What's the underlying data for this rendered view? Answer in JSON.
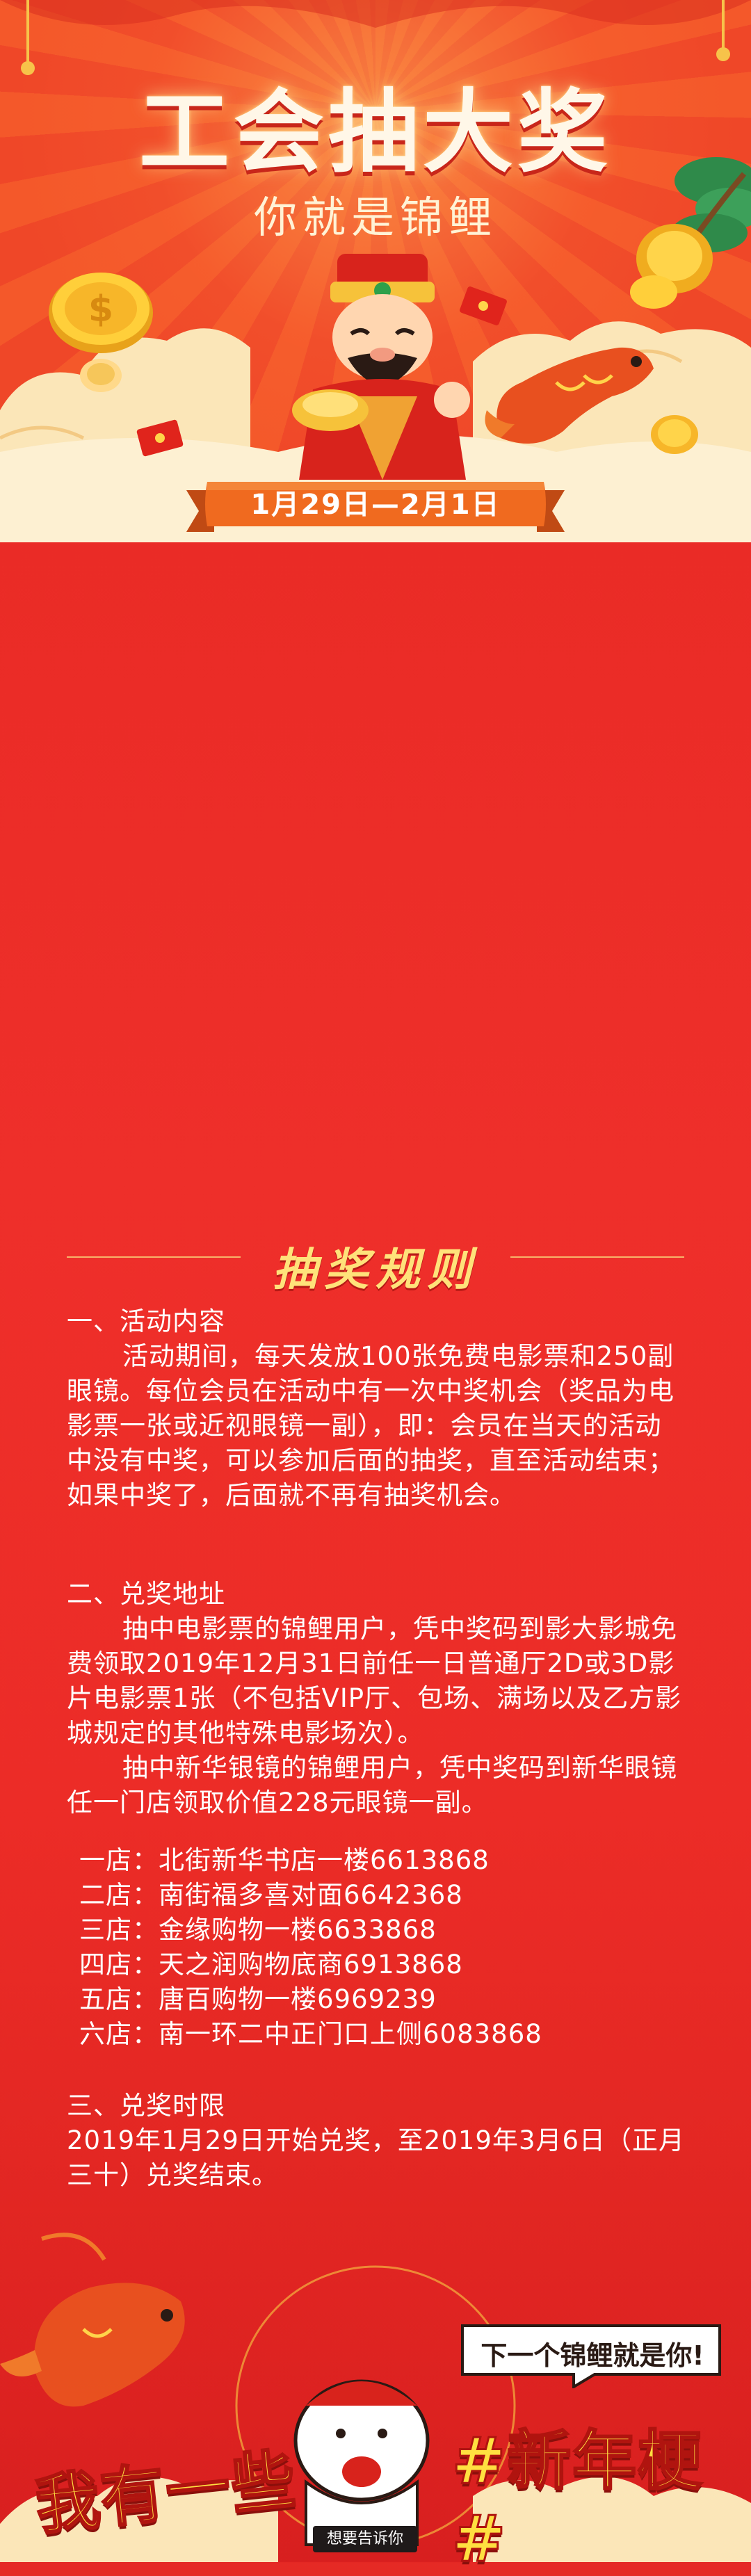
{
  "header": {
    "title": "工会抽大奖",
    "subtitle": "你就是锦鲤",
    "date_range": "1月29日—2月1日",
    "illustration": "god-of-wealth-with-koi-and-gold-coins"
  },
  "rules": {
    "heading": "抽奖规则",
    "section1": {
      "title": "一、活动内容",
      "paragraph": "活动期间，每天发放100张免费电影票和250副眼镜。每位会员在活动中有一次中奖机会（奖品为电影票一张或近视眼镜一副），即：会员在当天的活动中没有中奖，可以参加后面的抽奖，直至活动结束；如果中奖了，后面就不再有抽奖机会。"
    },
    "section2": {
      "title": "二、兑奖地址",
      "paragraph1": "抽中电影票的锦鲤用户，凭中奖码到影大影城免费领取2019年12月31日前任一日普通厅2D或3D影片电影票1张（不包括VIP厅、包场、满场以及乙方影城规定的其他特殊电影场次）。",
      "paragraph2": "抽中新华银镜的锦鲤用户，凭中奖码到新华眼镜任一门店领取价值228元眼镜一副。",
      "stores": [
        "一店：北街新华书店一楼6613868",
        "二店：南街福多喜对面6642368",
        "三店：金缘购物一楼6633868",
        "四店：天之润购物底商6913868",
        "五店：唐百购物一楼6969239",
        "六店：南一环二中正门口上侧6083868"
      ]
    },
    "section3": {
      "title": "三、兑奖时限",
      "paragraph": "2019年1月29日开始兑奖，至2019年3月6日（正月三十）兑奖结束。"
    }
  },
  "footer": {
    "left_slogan": "我有一些",
    "right_slogan": "#新年梗#",
    "bubble": "下一个锦鲤就是你!",
    "tag": "想要告诉你"
  },
  "colors": {
    "background": "#e52a25",
    "accent_gold": "#ffe040",
    "ribbon": "#f26a1f",
    "text": "#ffffff"
  }
}
